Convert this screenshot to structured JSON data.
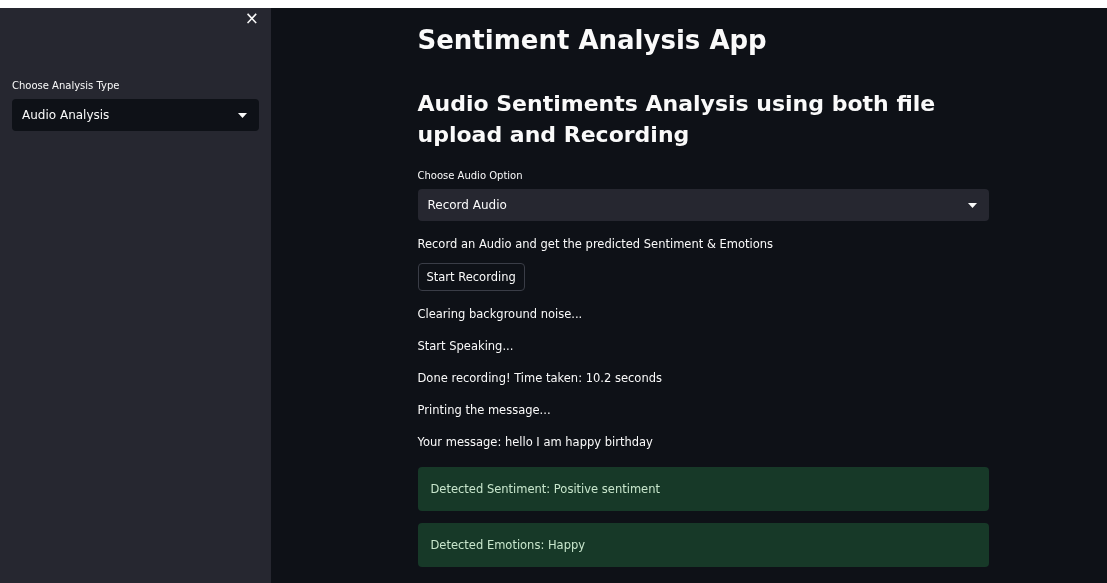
{
  "sidebar": {
    "close_icon": "×",
    "select_label": "Choose Analysis Type",
    "select_value": "Audio Analysis"
  },
  "main": {
    "title": "Sentiment Analysis App",
    "subheader": "Audio Sentiments Analysis using both file upload and Recording",
    "select_label": "Choose Audio Option",
    "select_value": "Record Audio",
    "blocks": [
      {
        "kind": "text",
        "text": "Record an Audio and get the predicted Sentiment & Emotions"
      },
      {
        "kind": "button",
        "text": "Start Recording"
      },
      {
        "kind": "text",
        "text": "Clearing background noise..."
      },
      {
        "kind": "text",
        "text": "Start Speaking..."
      },
      {
        "kind": "text",
        "text": "Done recording! Time taken: 10.2 seconds"
      },
      {
        "kind": "text",
        "text": "Printing the message..."
      },
      {
        "kind": "text",
        "text": "Your message: hello I am happy birthday"
      },
      {
        "kind": "success",
        "text": "Detected Sentiment: Positive sentiment"
      },
      {
        "kind": "success",
        "text": "Detected Emotions: Happy"
      }
    ]
  }
}
